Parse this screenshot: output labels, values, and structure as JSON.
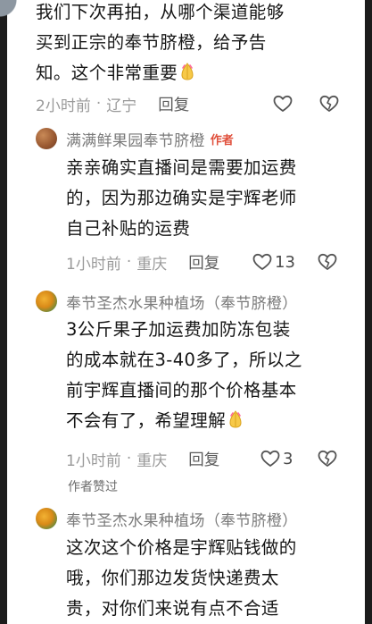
{
  "comments": [
    {
      "text_lines": [
        "我们下次再拍，从哪个渠道能够",
        "买到正宗的奉节脐橙，给予告",
        "知。这个非常重要"
      ],
      "time": "2小时前",
      "location": "辽宁",
      "reply_label": "回复",
      "like_count": ""
    },
    {
      "author": "满满鲜果园奉节脐橙",
      "author_tag": "作者",
      "text_lines": [
        "亲亲确实直播间是需要加运费",
        "的，因为那边确实是宇辉老师",
        "自己补贴的运费"
      ],
      "time": "1小时前",
      "location": "重庆",
      "reply_label": "回复",
      "like_count": "13"
    },
    {
      "author": "奉节圣杰水果种植场（奉节脐橙）",
      "text_lines": [
        "3公斤果子加运费加防冻包装",
        "的成本就在3-40多了，所以之",
        "前宇辉直播间的那个价格基本",
        "不会有了，希望理解"
      ],
      "time": "1小时前",
      "location": "重庆",
      "reply_label": "回复",
      "like_count": "3",
      "liked_by_author": "作者赞过"
    },
    {
      "author": "奉节圣杰水果种植场（奉节脐橙）",
      "text_lines": [
        "这次这个价格是宇辉贴钱做的",
        "哦，你们那边发货快递费太",
        "贵，对你们来说有点不合适"
      ]
    }
  ],
  "colors": {
    "author_tag": "#e0503c",
    "meta": "#8a8a8a",
    "text": "#161616"
  },
  "icons": {
    "like": "heart-outline-icon",
    "dislike": "broken-heart-outline-icon",
    "emoji": "folded-hands-emoji"
  }
}
